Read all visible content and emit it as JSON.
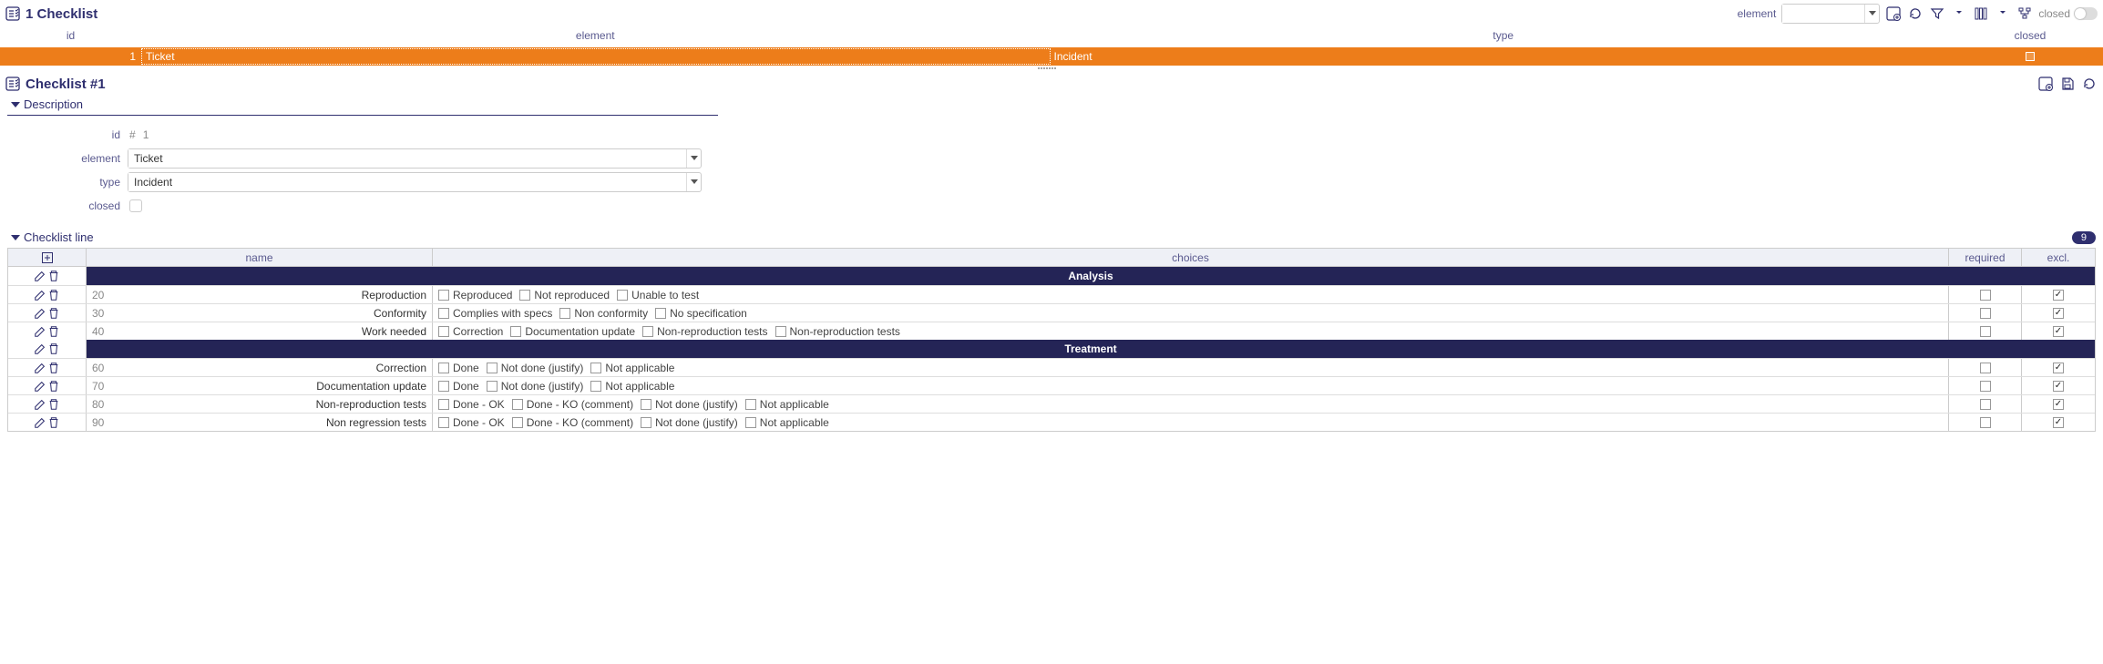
{
  "top": {
    "title": "1 Checklist",
    "filter_element_label": "element",
    "filter_closed_label": "closed",
    "filter_element_value": "",
    "cols": {
      "id": "id",
      "element": "element",
      "type": "type",
      "closed": "closed"
    },
    "row": {
      "id": "1",
      "element": "Ticket",
      "type": "Incident"
    }
  },
  "detail": {
    "title": "Checklist  #1",
    "section_description": "Description",
    "fields": {
      "id_label": "id",
      "id_hash": "#",
      "id_value": "1",
      "element_label": "element",
      "element_value": "Ticket",
      "type_label": "type",
      "type_value": "Incident",
      "closed_label": "closed"
    }
  },
  "lines": {
    "section_label": "Checklist line",
    "count": "9",
    "cols": {
      "name": "name",
      "choices": "choices",
      "required": "required",
      "excl": "excl."
    },
    "groups": [
      {
        "title": "Analysis",
        "rows": [
          {
            "seq": "20",
            "name": "Reproduction",
            "choices": [
              "Reproduced",
              "Not reproduced",
              "Unable to test"
            ],
            "required": false,
            "excl": true
          },
          {
            "seq": "30",
            "name": "Conformity",
            "choices": [
              "Complies with specs",
              "Non conformity",
              "No specification"
            ],
            "required": false,
            "excl": true
          },
          {
            "seq": "40",
            "name": "Work needed",
            "choices": [
              "Correction",
              "Documentation update",
              "Non-reproduction tests",
              "Non-reproduction tests"
            ],
            "required": false,
            "excl": true
          }
        ]
      },
      {
        "title": "Treatment",
        "rows": [
          {
            "seq": "60",
            "name": "Correction",
            "choices": [
              "Done",
              "Not done (justify)",
              "Not applicable"
            ],
            "required": false,
            "excl": true
          },
          {
            "seq": "70",
            "name": "Documentation update",
            "choices": [
              "Done",
              "Not done (justify)",
              "Not applicable"
            ],
            "required": false,
            "excl": true
          },
          {
            "seq": "80",
            "name": "Non-reproduction tests",
            "choices": [
              "Done - OK",
              "Done - KO (comment)",
              "Not done (justify)",
              "Not applicable"
            ],
            "required": false,
            "excl": true
          },
          {
            "seq": "90",
            "name": "Non regression tests",
            "choices": [
              "Done - OK",
              "Done - KO (comment)",
              "Not done (justify)",
              "Not applicable"
            ],
            "required": false,
            "excl": true
          }
        ]
      }
    ]
  }
}
